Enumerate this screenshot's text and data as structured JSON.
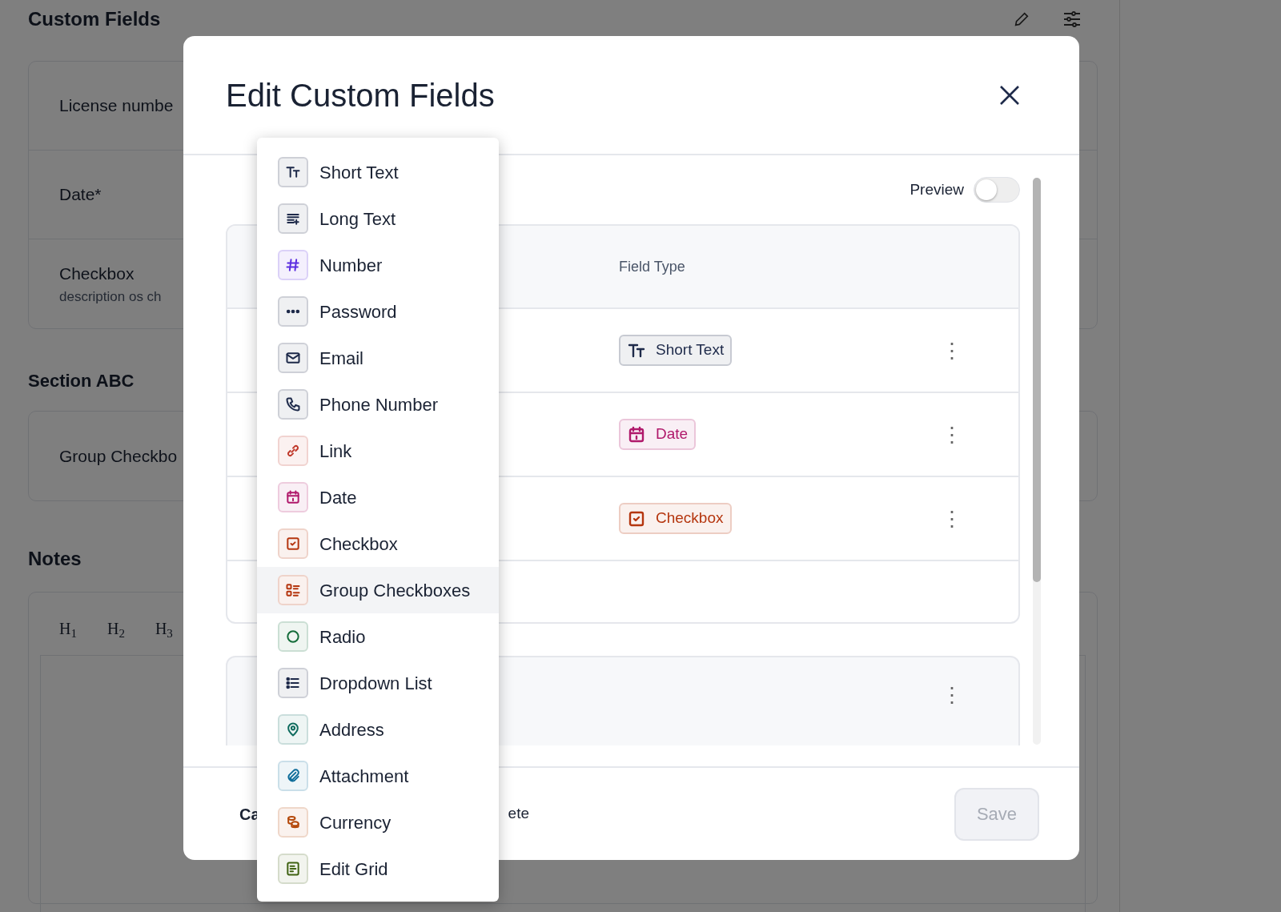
{
  "page": {
    "title": "Custom Fields",
    "fields": [
      {
        "label": "License numbe"
      },
      {
        "label": "Date*"
      },
      {
        "label": "Checkbox",
        "description": "description os ch"
      }
    ],
    "section": {
      "title": "Section ABC",
      "fields": [
        {
          "label": "Group Checkbo"
        }
      ]
    },
    "notes": {
      "title": "Notes",
      "toolbar": [
        "H$_{1}$",
        "H$_{2}$",
        "H$_{3}$"
      ]
    }
  },
  "modal": {
    "title": "Edit Custom Fields",
    "preview": {
      "label": "Preview",
      "on": false
    },
    "table": {
      "columns": [
        "Field Type"
      ],
      "rows": [
        {
          "type": "Short Text",
          "kind": "shorttext",
          "color": "#1e2a4a",
          "menu": "⋮"
        },
        {
          "type": "Date",
          "kind": "date",
          "color": "#b0196b",
          "menu": "⋮"
        },
        {
          "type": "Checkbox",
          "kind": "checkbox",
          "color": "#b5360f",
          "menu": "⋮"
        }
      ]
    },
    "second_card": {
      "menu": "⋮"
    },
    "footer": {
      "cancel": "Ca",
      "delete": "ete",
      "save": {
        "label": "Save",
        "disabled": true
      }
    }
  },
  "menu": {
    "items": [
      {
        "label": "Short Text",
        "kind": "shorttext",
        "color": "#1e2a4a",
        "highlighted": false
      },
      {
        "label": "Long Text",
        "kind": "longtext",
        "color": "#1e2a4a",
        "highlighted": false
      },
      {
        "label": "Number",
        "kind": "number",
        "color": "#5b2ee0",
        "highlighted": false
      },
      {
        "label": "Password",
        "kind": "password",
        "color": "#1e2a4a",
        "highlighted": false
      },
      {
        "label": "Email",
        "kind": "email",
        "color": "#1e2a4a",
        "highlighted": false
      },
      {
        "label": "Phone Number",
        "kind": "phone",
        "color": "#1e2a4a",
        "highlighted": false
      },
      {
        "label": "Link",
        "kind": "link",
        "color": "#c0392b",
        "highlighted": false
      },
      {
        "label": "Date",
        "kind": "date",
        "color": "#b0196b",
        "highlighted": false
      },
      {
        "label": "Checkbox",
        "kind": "checkbox",
        "color": "#b5360f",
        "highlighted": false
      },
      {
        "label": "Group Checkboxes",
        "kind": "checkgroup",
        "color": "#b5360f",
        "highlighted": true
      },
      {
        "label": "Radio",
        "kind": "radio",
        "color": "#146c3a",
        "highlighted": false
      },
      {
        "label": "Dropdown List",
        "kind": "dropdown",
        "color": "#1e2a4a",
        "highlighted": false
      },
      {
        "label": "Address",
        "kind": "address",
        "color": "#0f6b5e",
        "highlighted": false
      },
      {
        "label": "Attachment",
        "kind": "attachment",
        "color": "#0e6d9a",
        "highlighted": false
      },
      {
        "label": "Currency",
        "kind": "currency",
        "color": "#b4480a",
        "highlighted": false
      },
      {
        "label": "Edit Grid",
        "kind": "grid",
        "color": "#3f6212",
        "highlighted": false
      }
    ]
  }
}
